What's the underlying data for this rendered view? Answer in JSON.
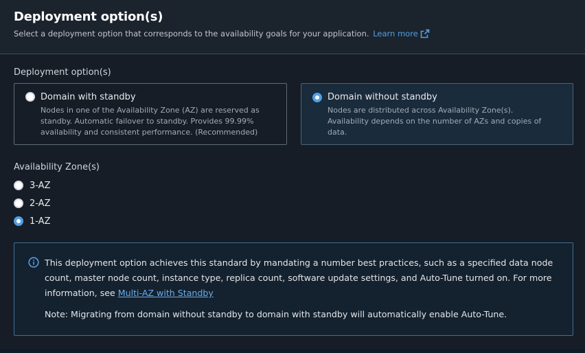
{
  "header": {
    "title": "Deployment option(s)",
    "description": "Select a deployment option that corresponds to the availability goals for your application.",
    "learn_more": "Learn more",
    "external_icon": "external-link-icon"
  },
  "deployment": {
    "label": "Deployment option(s)",
    "options": [
      {
        "title": "Domain with standby",
        "description": "Nodes in one of the Availability Zone (AZ) are reserved as standby. Automatic failover to standby. Provides 99.99% availability and consistent performance. (Recommended)",
        "selected": false
      },
      {
        "title": "Domain without standby",
        "description": "Nodes are distributed across Availability Zone(s). Availability depends on the number of AZs and copies of data.",
        "selected": true
      }
    ]
  },
  "availability_zones": {
    "label": "Availability Zone(s)",
    "options": [
      {
        "label": "3-AZ",
        "selected": false
      },
      {
        "label": "2-AZ",
        "selected": false
      },
      {
        "label": "1-AZ",
        "selected": true
      }
    ]
  },
  "info": {
    "icon": "info-icon",
    "text_before_link": "This deployment option achieves this standard by mandating a number best practices, such as a specified data node count, master node count, instance type, replica count, software update settings, and Auto-Tune turned on. For more information, see ",
    "link_text": "Multi-AZ with Standby",
    "note": "Note: Migrating from domain without standby to domain with standby will automatically enable Auto-Tune."
  },
  "colors": {
    "accent": "#539fe5",
    "panel_bg": "#161d26",
    "info_border": "#3f6f9c"
  }
}
